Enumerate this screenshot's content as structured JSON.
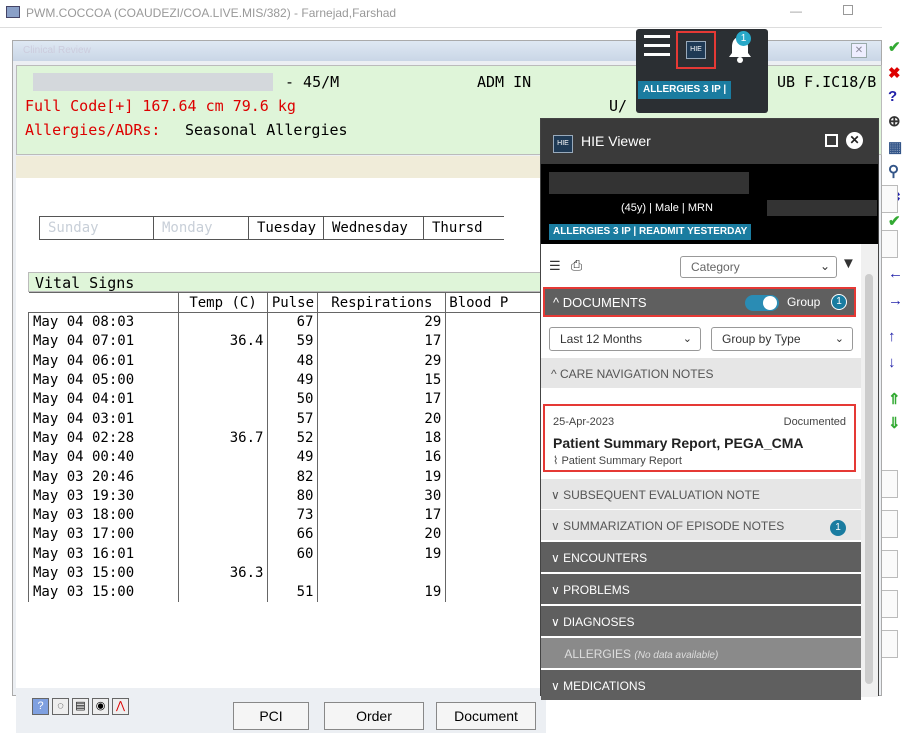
{
  "window": {
    "title": "PWM.COCCOA (COAUDEZI/COA.LIVE.MIS/382) - Farnejad,Farshad"
  },
  "clinical": {
    "title": "Clinical Review",
    "banner": {
      "age_sex": "- 45/M",
      "adm": "ADM IN",
      "location": "UB F.IC18/B",
      "code": "Full Code[+] 167.64 cm 79.6 kg",
      "allergies_label": "Allergies/ADRs:",
      "allergies_value": "Seasonal Allergies"
    },
    "days": [
      "Tuesday",
      "Wednesday",
      "Thursd"
    ],
    "vitals": {
      "title": "Vital Signs",
      "columns": [
        "Temp (C)",
        "Pulse",
        "Respirations",
        "Blood P"
      ],
      "rows": [
        {
          "time": "May 04 08:03",
          "temp": "",
          "pulse": "67",
          "resp": "29"
        },
        {
          "time": "May 04 07:01",
          "temp": "36.4",
          "pulse": "59",
          "resp": "17"
        },
        {
          "time": "May 04 06:01",
          "temp": "",
          "pulse": "48",
          "resp": "29"
        },
        {
          "time": "May 04 05:00",
          "temp": "",
          "pulse": "49",
          "resp": "15"
        },
        {
          "time": "May 04 04:01",
          "temp": "",
          "pulse": "50",
          "resp": "17"
        },
        {
          "time": "May 04 03:01",
          "temp": "",
          "pulse": "57",
          "resp": "20"
        },
        {
          "time": "May 04 02:28",
          "temp": "36.7",
          "pulse": "52",
          "resp": "18"
        },
        {
          "time": "May 04 00:40",
          "temp": "",
          "pulse": "49",
          "resp": "16"
        },
        {
          "time": "May 03 20:46",
          "temp": "",
          "pulse": "82",
          "resp": "19"
        },
        {
          "time": "May 03 19:30",
          "temp": "",
          "pulse": "80",
          "resp": "30"
        },
        {
          "time": "May 03 18:00",
          "temp": "",
          "pulse": "73",
          "resp": "17"
        },
        {
          "time": "May 03 17:00",
          "temp": "",
          "pulse": "66",
          "resp": "20"
        },
        {
          "time": "May 03 16:01",
          "temp": "",
          "pulse": "60",
          "resp": "19"
        },
        {
          "time": "May 03 15:00",
          "temp": "36.3",
          "pulse": "",
          "resp": ""
        },
        {
          "time": "May 03 15:00",
          "temp": "",
          "pulse": "51",
          "resp": "19"
        }
      ]
    },
    "buttons": {
      "pci": "PCI",
      "order": "Order",
      "document": "Document"
    }
  },
  "hie_widget": {
    "pills": "ALLERGIES 3 IP |",
    "bell_count": "1",
    "hie_label": "HIE"
  },
  "hie_viewer": {
    "title": "HIE Viewer",
    "demographics": "(45y) | Male | MRN",
    "pills": "ALLERGIES  3 IP | READMIT YESTERDAY",
    "category_placeholder": "Category",
    "documents_label": "DOCUMENTS",
    "group_label": "Group",
    "group_count": "1",
    "range_filter": "Last 12 Months",
    "group_by": "Group by Type",
    "sections": {
      "care_navigation": "CARE NAVIGATION NOTES",
      "subsequent": "SUBSEQUENT EVALUATION NOTE",
      "summarization": "SUMMARIZATION OF EPISODE NOTES",
      "summarization_count": "1",
      "encounters": "ENCOUNTERS",
      "problems": "PROBLEMS",
      "diagnoses": "DIAGNOSES",
      "allergies": "ALLERGIES",
      "allergies_note": "(No data available)",
      "medications": "MEDICATIONS"
    },
    "card": {
      "date": "25-Apr-2023",
      "status": "Documented",
      "title": "Patient Summary Report, PEGA_CMA",
      "subtitle": "Patient Summary Report"
    }
  },
  "colors": {
    "accent": "#1a7ca0",
    "highlight": "#e53935",
    "banner": "#dff5d9"
  }
}
